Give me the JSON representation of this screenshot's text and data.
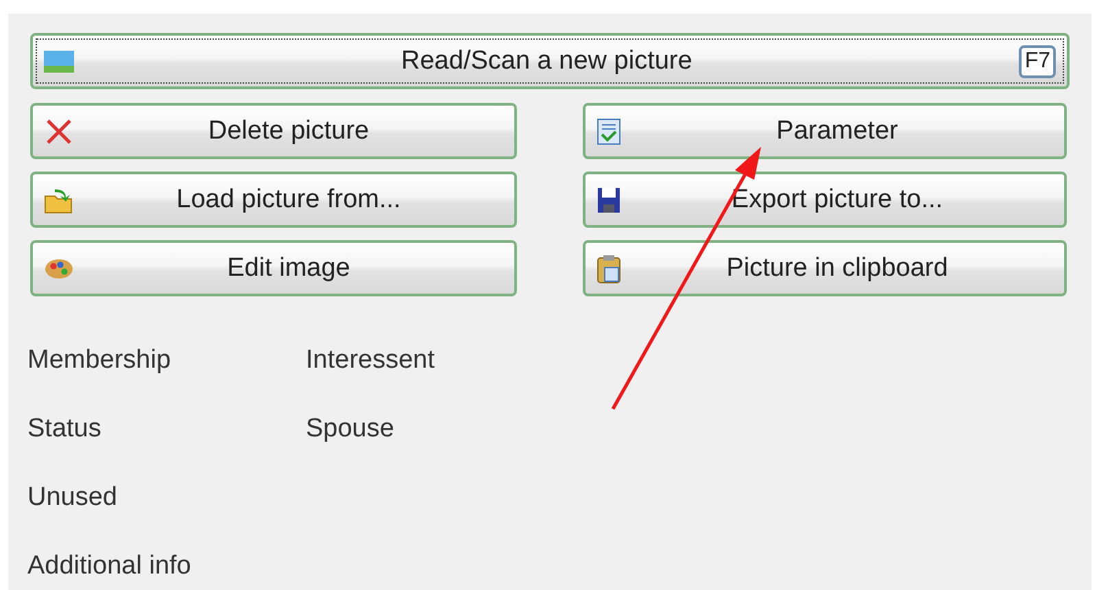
{
  "main_button": {
    "label": "Read/Scan a new picture",
    "shortcut": "F7",
    "focused": true
  },
  "buttons": [
    {
      "label": "Delete picture",
      "focused": false
    },
    {
      "label": "Parameter",
      "focused": false
    },
    {
      "label": "Load picture from...",
      "focused": false
    },
    {
      "label": "Export picture to...",
      "focused": false
    },
    {
      "label": "Edit image",
      "focused": false
    },
    {
      "label": "Picture in clipboard",
      "focused": false
    }
  ],
  "fields": [
    [
      "Membership",
      "Interessent"
    ],
    [
      "Status",
      "Spouse"
    ],
    [
      "Unused"
    ],
    [
      "Additional info"
    ]
  ]
}
